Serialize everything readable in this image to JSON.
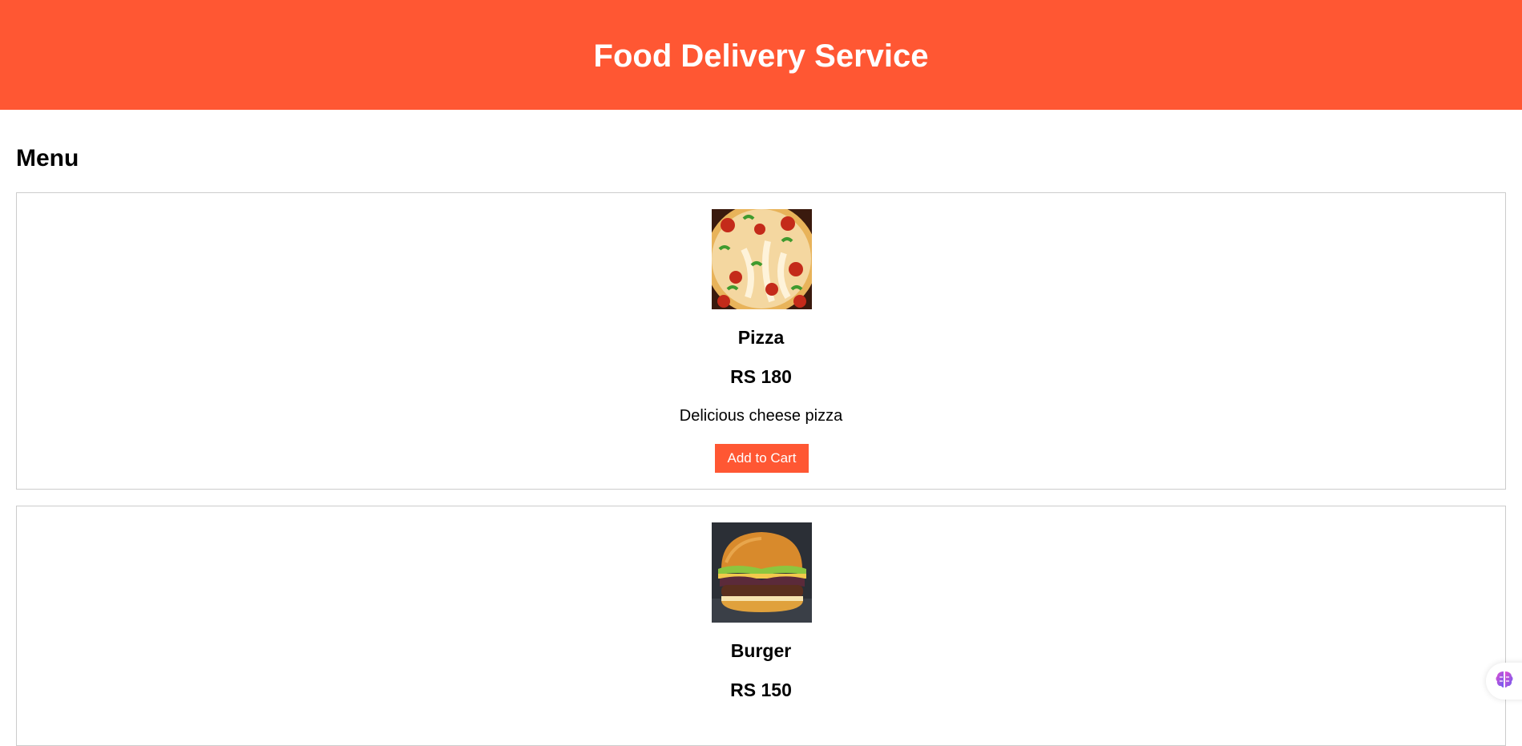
{
  "header": {
    "title": "Food Delivery Service",
    "background_color": "#ff5733"
  },
  "menu": {
    "heading": "Menu",
    "items": [
      {
        "name": "Pizza",
        "price": "RS 180",
        "description": "Delicious cheese pizza",
        "button_label": "Add to Cart",
        "image_icon": "pizza-image"
      },
      {
        "name": "Burger",
        "price": "RS 150",
        "image_icon": "burger-image"
      }
    ]
  },
  "assistant": {
    "icon": "brain-icon"
  },
  "colors": {
    "accent": "#ff5733",
    "card_border": "#cccccc"
  }
}
